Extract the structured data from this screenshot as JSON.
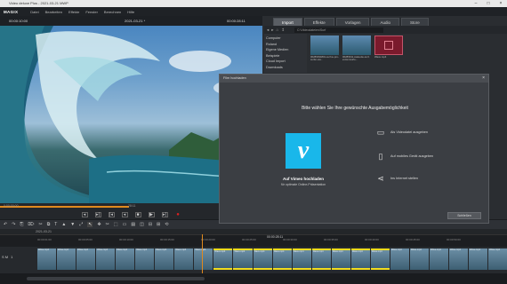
{
  "window": {
    "title": "Video deluxe Plus - 2021-03-21 MWP",
    "controls": [
      "–",
      "□",
      "×"
    ]
  },
  "menu": {
    "logo": "MAGIX",
    "items": [
      "Datei",
      "Bearbeiten",
      "Effekte",
      "Fenster",
      "Berechnen",
      "Hilfe"
    ]
  },
  "preview": {
    "timecode_left": "00:00:10:00",
    "title": "2021-03-21 *",
    "timecode_right": "00:00:28:11",
    "progress": 0.49,
    "time_start": "0:00:00:00",
    "time_mid": "28:11"
  },
  "playback": {
    "buttons": [
      "◂",
      "▸|",
      "|◂",
      "◂",
      "■",
      "▶",
      "▸|",
      "●"
    ]
  },
  "toolbar": {
    "buttons": [
      "↶",
      "↷",
      "⎘",
      "⌦",
      "✂",
      "⧉",
      "T",
      "▲",
      "▼",
      "⤢",
      "↖",
      "✥",
      "✂",
      "⬚",
      "▭",
      "▤",
      "◫",
      "⊟",
      "⊞",
      "⟲"
    ]
  },
  "timeline": {
    "project": "2021-03-21",
    "current_tc": "00:00:28:11",
    "ticks": [
      "00:00:01:00",
      "00:00:05:00",
      "00:00:10:00",
      "00:00:15:00",
      "00:00:20:00",
      "00:00:25:00",
      "00:00:30:00",
      "00:00:35:00",
      "00:00:40:00",
      "00:00:45:00",
      "00:00:50:00"
    ],
    "track_label": "S M",
    "track_number": "1",
    "clips": [
      "Wave.mp4",
      "Wave.mp4",
      "Wave.mp4",
      "Wave.mp4",
      "Wave.mp4",
      "Wave.mp4",
      "Wave.mp4",
      "Wave.mp4",
      "Wave.mp4",
      "Wave.mp4",
      "Wave.mp4",
      "Wave.mp4",
      "Wave.mp4",
      "Wave.mp4",
      "Wave.mp4",
      "Wave.mp4",
      "Wave.mp4",
      "Wave.mp4",
      "Wave.mp4",
      "Wave.mp4",
      "Wave.mp4",
      "Wave.mp4",
      "Wave.mp4",
      "Wave.mp4"
    ],
    "selected_clips": [
      9,
      10,
      11,
      12,
      13,
      14,
      15,
      16,
      17
    ]
  },
  "media": {
    "tabs": [
      "Import",
      "Effekte",
      "Vorlagen",
      "Audio",
      "Store"
    ],
    "active_tab": 0,
    "nav": [
      "◂",
      "▸",
      "⌂",
      "↥"
    ],
    "path": "C:\\Videodateien\\Surf",
    "sources": [
      "Computer",
      "Roland",
      "Eigene Medien",
      "Beispiele",
      "Cloud Import",
      "Downloads"
    ],
    "thumbnails": [
      {
        "caption": "06286094801-surf-te-pro-surfer-wa..."
      },
      {
        "caption": "06286911-statuette-surf-extremsurfe..."
      },
      {
        "caption": "Wave.mp4"
      }
    ]
  },
  "dialog": {
    "title": "Film hochladen",
    "close": "×",
    "heading": "Bitte wählen Sie Ihre gewünschte Ausgabemöglichkeit",
    "vimeo_logo": "v",
    "vimeo_label": "Auf Vimeo hochladen",
    "vimeo_sub": "für optimale Online-Präsentation",
    "options": [
      {
        "icon": "folder-icon",
        "glyph": "▭",
        "label": "Als Videodatei ausgeben"
      },
      {
        "icon": "phone-icon",
        "glyph": "▯",
        "label": "Auf mobiles Gerät ausgeben"
      },
      {
        "icon": "share-icon",
        "glyph": "⋖",
        "label": "Ins Internet stellen"
      }
    ],
    "close_button": "Schließen"
  },
  "colors": {
    "accent": "#e08a1e",
    "vimeo": "#19b7ea",
    "selection": "#f2dc1c"
  }
}
